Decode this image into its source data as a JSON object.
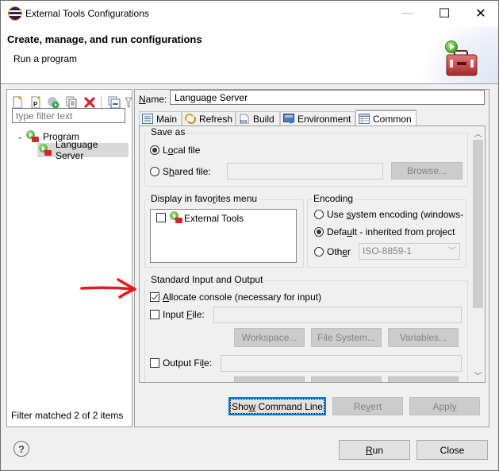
{
  "window": {
    "title": "External Tools Configurations",
    "controls": {
      "minimize": "—",
      "maximize": "☐",
      "close": "✕"
    }
  },
  "header": {
    "title": "Create, manage, and run configurations",
    "subtitle": "Run a program",
    "icon": "toolbox-run-icon"
  },
  "left_panel": {
    "toolbar": [
      {
        "name": "new-configuration",
        "icon": "new-file-icon"
      },
      {
        "name": "new-prototype",
        "icon": "new-prototype-icon"
      },
      {
        "name": "export",
        "icon": "export-icon"
      },
      {
        "name": "duplicate",
        "icon": "duplicate-icon"
      },
      {
        "name": "delete",
        "icon": "delete-icon"
      },
      {
        "name": "collapse-all",
        "icon": "collapse-all-icon"
      },
      {
        "name": "filter",
        "icon": "filter-icon"
      }
    ],
    "filter_placeholder": "type filter text",
    "tree": [
      {
        "label": "Program",
        "expanded": true,
        "children": [
          {
            "label": "Language Server",
            "selected": true
          }
        ]
      }
    ],
    "status": "Filter matched 2 of 2 items"
  },
  "config": {
    "name_label": "Name:",
    "name_value": "Language Server",
    "tabs": [
      {
        "label": "Main",
        "icon": "main-tab-icon",
        "active": false
      },
      {
        "label": "Refresh",
        "icon": "refresh-icon",
        "active": false
      },
      {
        "label": "Build",
        "icon": "build-icon",
        "active": false
      },
      {
        "label": "Environment",
        "icon": "environment-icon",
        "active": false
      },
      {
        "label": "Common",
        "icon": "common-tab-icon",
        "active": true
      }
    ],
    "save_as": {
      "group_label": "Save as",
      "local_file": {
        "label": "Local file",
        "selected": true
      },
      "shared_file": {
        "label": "Shared file:",
        "selected": false,
        "value": ""
      },
      "browse_label": "Browse..."
    },
    "favorites": {
      "group_label": "Display in favorites menu",
      "items": [
        {
          "label": "External Tools",
          "checked": false
        }
      ]
    },
    "encoding": {
      "group_label": "Encoding",
      "options": [
        {
          "label": "Use system encoding (windows-",
          "selected": false
        },
        {
          "label": "Default - inherited from project",
          "selected": true
        },
        {
          "label": "Other",
          "selected": false
        }
      ],
      "other_value": "ISO-8859-1"
    },
    "std_io": {
      "group_label": "Standard Input and Output",
      "allocate_console": {
        "label": "Allocate console (necessary for input)",
        "checked": true
      },
      "input_file": {
        "label": "Input File:",
        "checked": false,
        "value": ""
      },
      "output_file": {
        "label": "Output File:",
        "checked": false,
        "value": ""
      },
      "buttons": [
        "Workspace...",
        "File System...",
        "Variables..."
      ]
    },
    "actions": {
      "show_command_line": "Show Command Line",
      "revert": "Revert",
      "apply": "Apply"
    }
  },
  "footer": {
    "help_icon": "help-icon",
    "run": "Run",
    "close": "Close"
  },
  "annotation": {
    "arrow_color": "#e8191e"
  },
  "colors": {
    "focus_border": "#0078d7",
    "disabled_button": "#cccccc",
    "selection": "#d9d9d9"
  }
}
